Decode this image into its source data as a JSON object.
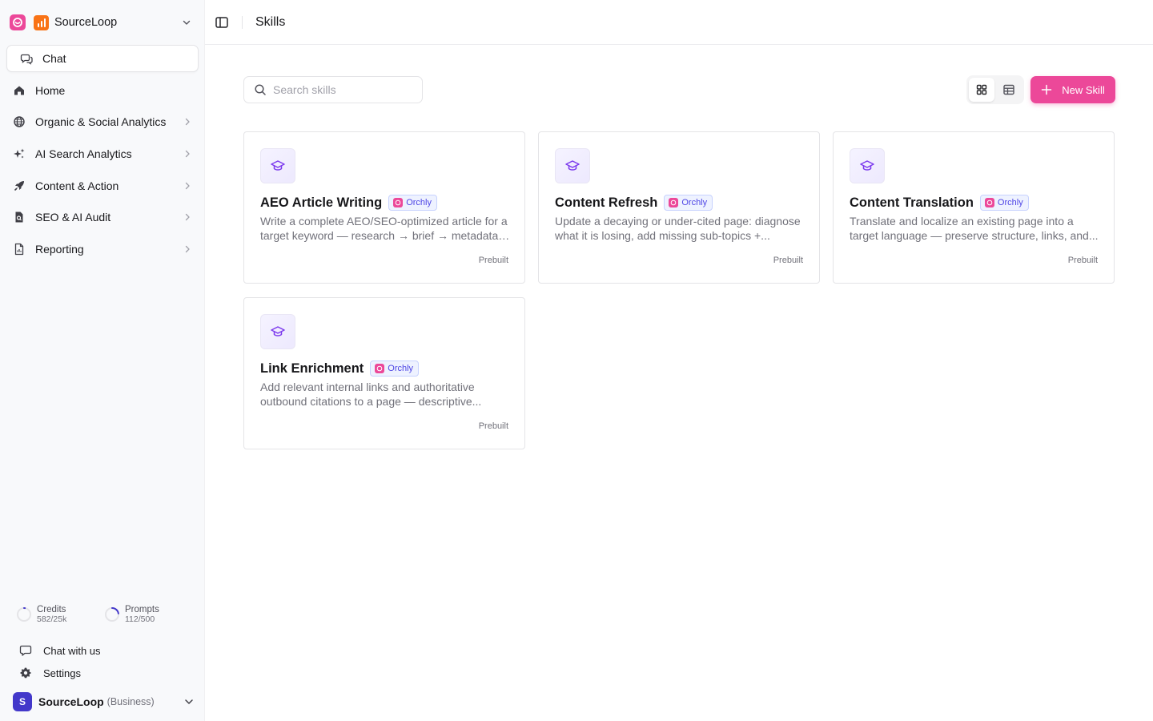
{
  "sidebar": {
    "workspace": {
      "name": "SourceLoop"
    },
    "chat_label": "Chat",
    "items": [
      {
        "label": "Home",
        "icon": "home-icon",
        "has_children": false
      },
      {
        "label": "Organic & Social Analytics",
        "icon": "globe-icon",
        "has_children": true
      },
      {
        "label": "AI Search Analytics",
        "icon": "sparkles-icon",
        "has_children": true
      },
      {
        "label": "Content & Action",
        "icon": "rocket-icon",
        "has_children": true
      },
      {
        "label": "SEO & AI Audit",
        "icon": "audit-icon",
        "has_children": true
      },
      {
        "label": "Reporting",
        "icon": "report-icon",
        "has_children": true
      }
    ],
    "usage": {
      "credits": {
        "label": "Credits",
        "value": "582/25k",
        "fraction": 0.023
      },
      "prompts": {
        "label": "Prompts",
        "value": "112/500",
        "fraction": 0.224
      }
    },
    "chat_with_us": "Chat with us",
    "settings": "Settings",
    "account": {
      "initial": "S",
      "name": "SourceLoop",
      "plan": "(Business)"
    }
  },
  "header": {
    "title": "Skills"
  },
  "toolbar": {
    "search_placeholder": "Search skills",
    "search_value": "",
    "new_skill_label": "New Skill",
    "view_mode": "grid"
  },
  "cards": [
    {
      "title": "AEO Article Writing",
      "badge": "Orchly",
      "desc_line1": "Write a complete AEO/SEO-optimized article for a",
      "desc_line2": "target keyword — research → brief → metadata ...",
      "tag": "Prebuilt"
    },
    {
      "title": "Content Refresh",
      "badge": "Orchly",
      "desc_line1": "Update a decaying or under-cited page: diagnose",
      "desc_line2": "what it is losing, add missing sub-topics +...",
      "tag": "Prebuilt"
    },
    {
      "title": "Content Translation",
      "badge": "Orchly",
      "desc_line1": "Translate and localize an existing page into a",
      "desc_line2": "target language — preserve structure, links, and...",
      "tag": "Prebuilt"
    },
    {
      "title": "Link Enrichment",
      "badge": "Orchly",
      "desc_line1": "Add relevant internal links and authoritative",
      "desc_line2": "outbound citations to a page — descriptive...",
      "tag": "Prebuilt"
    }
  ],
  "colors": {
    "accent": "#ec4899",
    "badge_text": "#4f46e5",
    "brand_icon": "#f97316",
    "avatar": "#4338ca"
  }
}
